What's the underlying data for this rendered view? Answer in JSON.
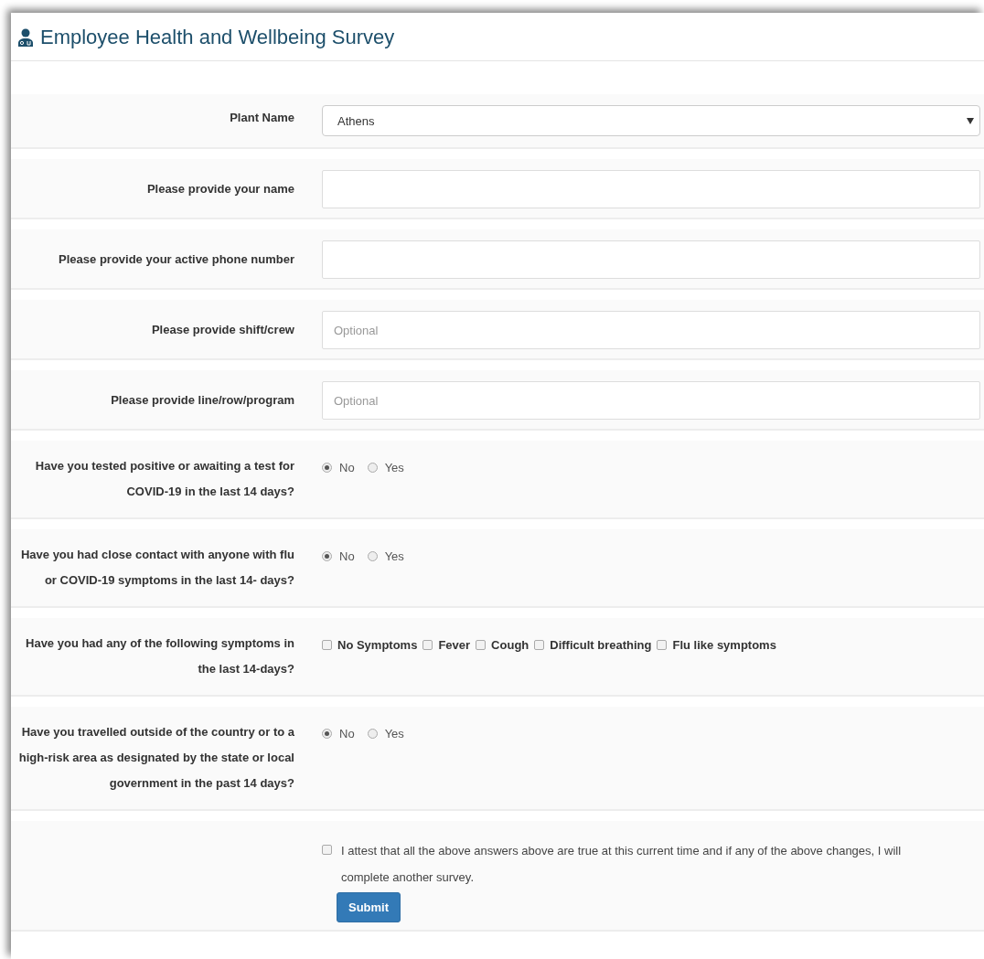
{
  "title": "Employee Health and Wellbeing Survey",
  "fields": [
    {
      "kind": "select",
      "label": "Plant Name",
      "value": "Athens"
    },
    {
      "kind": "text",
      "label": "Please provide your name"
    },
    {
      "kind": "text",
      "label": "Please provide your active phone number"
    },
    {
      "kind": "text",
      "label": "Please provide shift/crew",
      "placeholder": "Optional"
    },
    {
      "kind": "text",
      "label": "Please provide line/row/program",
      "placeholder": "Optional"
    },
    {
      "kind": "radio",
      "label": "Have you tested positive or awaiting a test for COVID-19 in the last 14 days?",
      "options": [
        {
          "label": "No",
          "selected": true
        },
        {
          "label": "Yes",
          "selected": false
        }
      ]
    },
    {
      "kind": "radio",
      "label": "Have you had close contact with anyone with flu or COVID-19 symptoms in the last 14- days?",
      "options": [
        {
          "label": "No",
          "selected": true
        },
        {
          "label": "Yes",
          "selected": false
        }
      ]
    },
    {
      "kind": "checkboxes",
      "label": "Have you had any of the following symptoms in the last 14-days?",
      "options": [
        {
          "label": "No Symptoms",
          "checked": false
        },
        {
          "label": "Fever",
          "checked": false
        },
        {
          "label": "Cough",
          "checked": false
        },
        {
          "label": "Difficult breathing",
          "checked": false
        },
        {
          "label": "Flu like symptoms",
          "checked": false
        }
      ]
    },
    {
      "kind": "radio",
      "label": "Have you travelled outside of the country or to a high-risk area as designated by the state or local government in the past 14 days?",
      "options": [
        {
          "label": "No",
          "selected": true
        },
        {
          "label": "Yes",
          "selected": false
        }
      ]
    }
  ],
  "attest": {
    "text": "I attest that all the above answers above are true at this current time and if any of the above changes, I will complete another survey.",
    "checked": false
  },
  "submit": "Submit"
}
